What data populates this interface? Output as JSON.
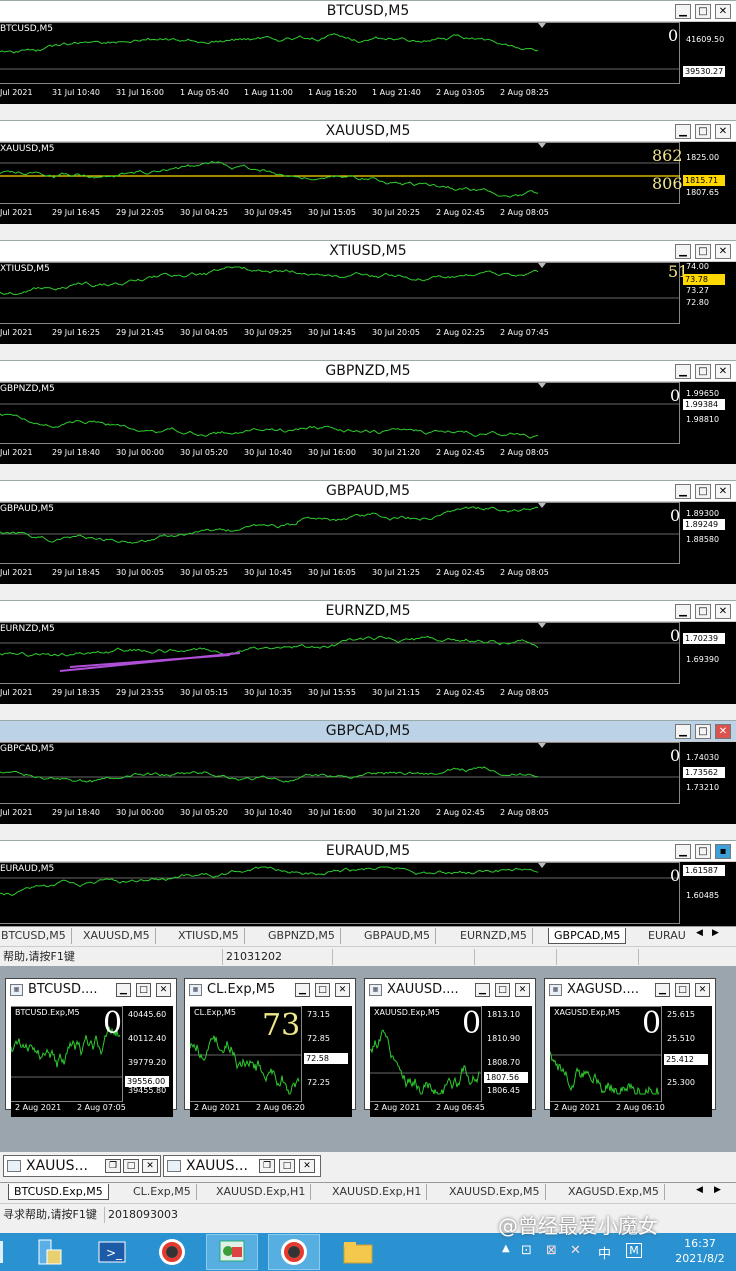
{
  "charts": [
    {
      "title": "BTCUSD,M5",
      "symbol": "BTCUSD,M5",
      "big": "0",
      "big_color": "white",
      "prices": [
        "41609.50",
        "39530.27"
      ],
      "times": [
        "Jul 2021",
        "31 Jul 10:40",
        "31 Jul 16:00",
        "1 Aug 05:40",
        "1 Aug 11:00",
        "1 Aug 16:20",
        "1 Aug 21:40",
        "2 Aug 03:05",
        "2 Aug 08:25"
      ]
    },
    {
      "title": "XAUUSD,M5",
      "symbol": "XAUUSD,M5",
      "big": "862",
      "big2": "806",
      "big_color": "yellow",
      "prices": [
        "1825.00",
        "1815.71",
        "1807.65"
      ],
      "times": [
        "Jul 2021",
        "29 Jul 16:45",
        "29 Jul 22:05",
        "30 Jul 04:25",
        "30 Jul 09:45",
        "30 Jul 15:05",
        "30 Jul 20:25",
        "2 Aug 02:45",
        "2 Aug 08:05"
      ]
    },
    {
      "title": "XTIUSD,M5",
      "symbol": "XTIUSD,M5",
      "big": "51",
      "big_color": "yellow",
      "prices": [
        "74.00",
        "73.78",
        "73.27",
        "72.80"
      ],
      "times": [
        "Jul 2021",
        "29 Jul 16:25",
        "29 Jul 21:45",
        "30 Jul 04:05",
        "30 Jul 09:25",
        "30 Jul 14:45",
        "30 Jul 20:05",
        "2 Aug 02:25",
        "2 Aug 07:45"
      ]
    },
    {
      "title": "GBPNZD,M5",
      "symbol": "GBPNZD,M5",
      "big": "0",
      "big_color": "white",
      "prices": [
        "1.99650",
        "1.99384",
        "1.98810"
      ],
      "times": [
        "Jul 2021",
        "29 Jul 18:40",
        "30 Jul 00:00",
        "30 Jul 05:20",
        "30 Jul 10:40",
        "30 Jul 16:00",
        "30 Jul 21:20",
        "2 Aug 02:45",
        "2 Aug 08:05"
      ]
    },
    {
      "title": "GBPAUD,M5",
      "symbol": "GBPAUD,M5",
      "big": "0",
      "big_color": "white",
      "prices": [
        "1.89300",
        "1.89249",
        "1.88580"
      ],
      "times": [
        "Jul 2021",
        "29 Jul 18:45",
        "30 Jul 00:05",
        "30 Jul 05:25",
        "30 Jul 10:45",
        "30 Jul 16:05",
        "30 Jul 21:25",
        "2 Aug 02:45",
        "2 Aug 08:05"
      ]
    },
    {
      "title": "EURNZD,M5",
      "symbol": "EURNZD,M5",
      "big": "0",
      "big_color": "white",
      "prices": [
        "1.70239",
        "1.69390"
      ],
      "times": [
        "Jul 2021",
        "29 Jul 18:35",
        "29 Jul 23:55",
        "30 Jul 05:15",
        "30 Jul 10:35",
        "30 Jul 15:55",
        "30 Jul 21:15",
        "2 Aug 02:45",
        "2 Aug 08:05"
      ]
    },
    {
      "title": "GBPCAD,M5",
      "symbol": "GBPCAD,M5",
      "big": "0",
      "big_color": "white",
      "prices": [
        "1.74030",
        "1.73562",
        "1.73210"
      ],
      "times": [
        "Jul 2021",
        "29 Jul 18:40",
        "30 Jul 00:00",
        "30 Jul 05:20",
        "30 Jul 10:40",
        "30 Jul 16:00",
        "30 Jul 21:20",
        "2 Aug 02:45",
        "2 Aug 08:05"
      ]
    },
    {
      "title": "EURAUD,M5",
      "symbol": "EURAUD,M5",
      "big": "0",
      "big_color": "white",
      "prices": [
        "1.61587",
        "1.60485"
      ],
      "times": []
    }
  ],
  "tabs": [
    "BTCUSD,M5",
    "XAUUSD,M5",
    "XTIUSD,M5",
    "GBPNZD,M5",
    "GBPAUD,M5",
    "EURNZD,M5",
    "GBPCAD,M5",
    "EURAU"
  ],
  "status1": {
    "help": "帮助,请按F1键",
    "code": "21031202"
  },
  "minis": [
    {
      "title": "BTCUSD....",
      "symbol": "BTCUSD.Exp,M5",
      "big": "0",
      "big_color": "white",
      "prices": [
        "40445.60",
        "40112.40",
        "39779.20",
        "39556.00",
        "39455.80"
      ],
      "times": [
        "2 Aug 2021",
        "2 Aug 07:05"
      ]
    },
    {
      "title": "CL.Exp,M5",
      "symbol": "CL.Exp,M5",
      "big": "73",
      "big_color": "yellow",
      "prices": [
        "73.15",
        "72.85",
        "72.58",
        "72.25"
      ],
      "times": [
        "2 Aug 2021",
        "2 Aug 06:20"
      ]
    },
    {
      "title": "XAUUSD....",
      "symbol": "XAUUSD.Exp,M5",
      "big": "0",
      "big_color": "white",
      "prices": [
        "1813.10",
        "1810.90",
        "1808.70",
        "1807.56",
        "1806.45"
      ],
      "times": [
        "2 Aug 2021",
        "2 Aug 06:45"
      ]
    },
    {
      "title": "XAGUSD....",
      "symbol": "XAGUSD.Exp,M5",
      "big": "0",
      "big_color": "white",
      "prices": [
        "25.615",
        "25.510",
        "25.412",
        "25.300"
      ],
      "times": [
        "2 Aug 2021",
        "2 Aug 06:10"
      ]
    }
  ],
  "minimized": [
    "XAUUS...",
    "XAUUS..."
  ],
  "tabs2": [
    "BTCUSD.Exp,M5",
    "CL.Exp,M5",
    "XAUUSD.Exp,H1",
    "XAUUSD.Exp,H1",
    "XAUUSD.Exp,M5",
    "XAGUSD.Exp,M5"
  ],
  "status2": {
    "help": "寻求帮助,请按F1键",
    "code": "2018093003"
  },
  "watermark": "@曾经最爱小魔女",
  "clock": {
    "time": "16:37",
    "date": "2021/8/2"
  },
  "tray": {
    "ime": "中",
    "m": "M"
  },
  "colors": {
    "line": "#2ecc2e",
    "bg": "#000000",
    "accent": "#2a92d0",
    "badge_yellow": "#ffd800"
  }
}
